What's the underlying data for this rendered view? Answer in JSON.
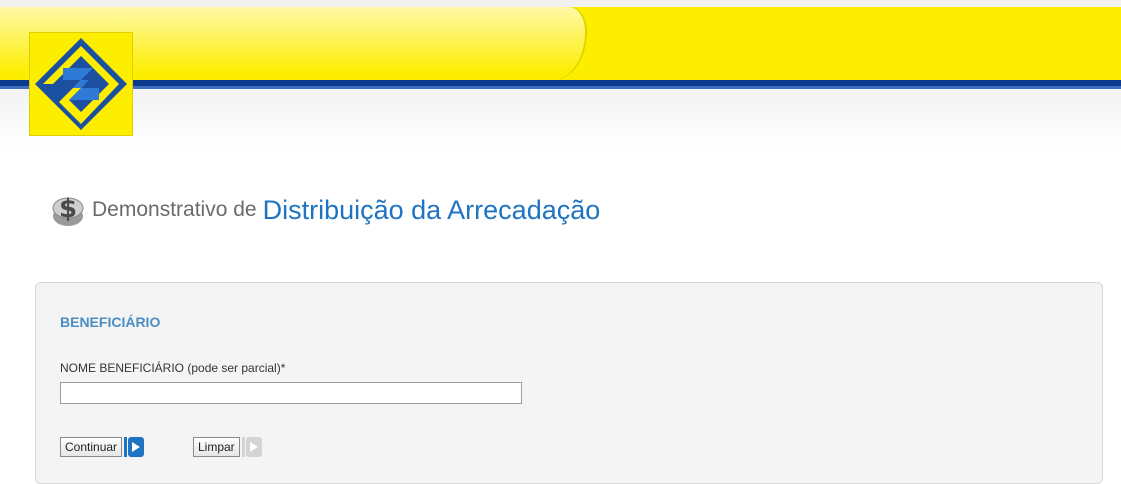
{
  "header": {
    "brand_colors": {
      "yellow": "#fdee00",
      "blue": "#0b3a8c"
    },
    "logo_icon": "banco-do-brasil-logo"
  },
  "title": {
    "icon": "dollar-coin-icon",
    "prefix": "Demonstrativo de",
    "main": "Distribuição da Arrecadação"
  },
  "form": {
    "section_title": "BENEFICIÁRIO",
    "name_label": "NOME BENEFICIÁRIO (pode ser parcial)*",
    "name_value": "",
    "continue_label": "Continuar",
    "clear_label": "Limpar",
    "accent_color": "#1e73c2"
  }
}
